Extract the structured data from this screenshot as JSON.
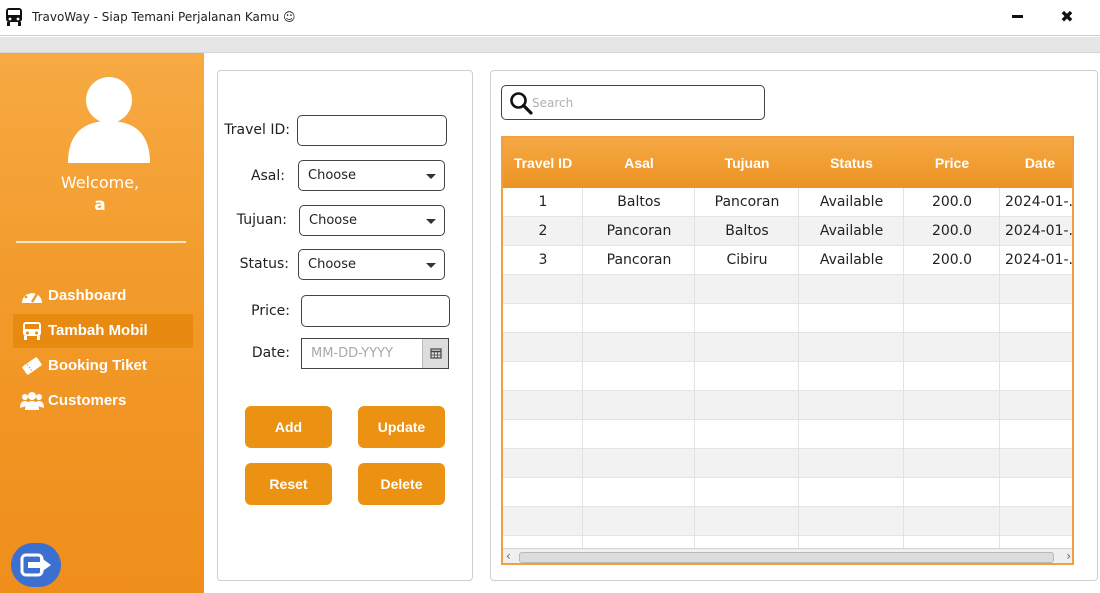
{
  "window": {
    "title": "TravoWay - Siap Temani Perjalanan Kamu ☺",
    "minimize_icon": "minimize-icon",
    "close_label": "✖"
  },
  "sidebar": {
    "welcome": "Welcome,",
    "username": "a",
    "active_color": "#e98a10",
    "items": [
      {
        "label": "Dashboard",
        "icon": "gauge-icon"
      },
      {
        "label": "Tambah Mobil",
        "icon": "bus-icon",
        "active": true
      },
      {
        "label": "Booking Tiket",
        "icon": "ticket-icon"
      },
      {
        "label": "Customers",
        "icon": "users-icon"
      }
    ],
    "logout_icon": "logout-icon"
  },
  "form": {
    "travel_id_label": "Travel ID:",
    "travel_id_value": "",
    "asal_label": "Asal:",
    "asal_value": "Choose",
    "tujuan_label": "Tujuan:",
    "tujuan_value": "Choose",
    "status_label": "Status:",
    "status_value": "Choose",
    "price_label": "Price:",
    "price_value": "",
    "date_label": "Date:",
    "date_placeholder": "MM-DD-YYYY",
    "buttons": {
      "add": "Add",
      "update": "Update",
      "reset": "Reset",
      "delete": "Delete"
    },
    "button_color": "#ec9213"
  },
  "search": {
    "placeholder": "Search"
  },
  "table": {
    "header_color": "#ef9527",
    "columns": [
      "Travel ID",
      "Asal",
      "Tujuan",
      "Status",
      "Price",
      "Date"
    ],
    "rows": [
      [
        "1",
        "Baltos",
        "Pancoran",
        "Available",
        "200.0",
        "2024-01-..."
      ],
      [
        "2",
        "Pancoran",
        "Baltos",
        "Available",
        "200.0",
        "2024-01-..."
      ],
      [
        "3",
        "Pancoran",
        "Cibiru",
        "Available",
        "200.0",
        "2024-01-..."
      ]
    ]
  }
}
